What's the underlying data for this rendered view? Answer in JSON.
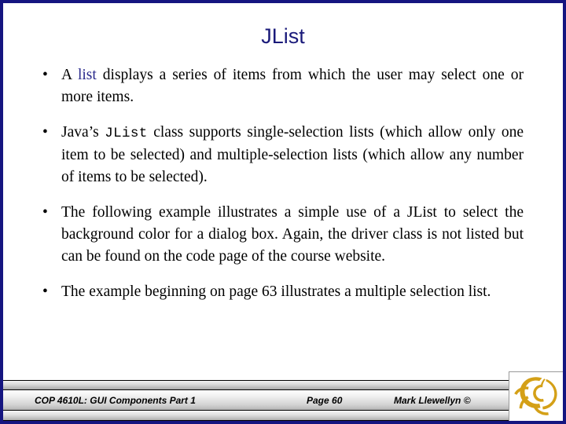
{
  "slide": {
    "title": "JList",
    "border_color": "#151580",
    "title_color": "#1a1a7a",
    "background_color": "#ffffff"
  },
  "bullets": [
    {
      "marker": "•",
      "parts": [
        {
          "text": "A ",
          "style": "normal"
        },
        {
          "text": "list",
          "style": "blue"
        },
        {
          "text": " displays a series of items from which the user may select one or more items.",
          "style": "normal"
        }
      ],
      "plain_text": "A list displays a series of items from which the user may select one or more items."
    },
    {
      "marker": "•",
      "parts": [
        {
          "text": "Java’s ",
          "style": "normal"
        },
        {
          "text": "JList",
          "style": "mono"
        },
        {
          "text": " class supports single-selection lists (which allow only one item to be selected) and multiple-selection lists (which allow any number of items to be selected).",
          "style": "normal"
        }
      ],
      "plain_text": "Java’s JList class supports single-selection lists (which allow only one item to be selected) and multiple-selection lists (which allow any number of items to be selected)."
    },
    {
      "marker": "•",
      "parts": [
        {
          "text": "The following example illustrates a simple use of a JList to select the background color for a dialog box.  Again, the driver class is not listed but can be found on the code page of the course website.",
          "style": "normal"
        }
      ],
      "plain_text": "The following example illustrates a simple use of a JList to select the background color for a dialog box.  Again, the driver class is not listed but can be found on the code page of the course website."
    },
    {
      "marker": "•",
      "parts": [
        {
          "text": "The example beginning on page 63 illustrates a multiple selection list.",
          "style": "normal"
        }
      ],
      "plain_text": "The example beginning on page 63 illustrates a multiple selection list."
    }
  ],
  "footer": {
    "course": "COP 4610L: GUI Components Part 1",
    "page": "Page 60",
    "author": "Mark Llewellyn ©",
    "logo_name": "ucf-pegasus-logo",
    "logo_color": "#d4a017"
  }
}
